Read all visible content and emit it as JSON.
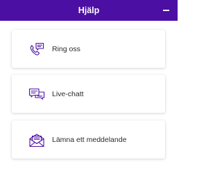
{
  "header": {
    "title": "Hjälp",
    "minimize_label": "Minimera"
  },
  "options": [
    {
      "label": "Ring oss",
      "icon": "phone-chat-icon"
    },
    {
      "label": "Live-chatt",
      "icon": "chat-bubbles-icon"
    },
    {
      "label": "Lämna ett meddelande",
      "icon": "envelope-letter-icon"
    }
  ],
  "colors": {
    "accent": "#4b0fa3",
    "header_text": "#ffffff",
    "label_text": "#2a2a2a"
  }
}
